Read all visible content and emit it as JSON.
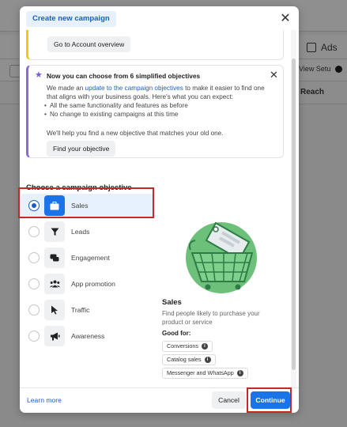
{
  "background": {
    "ads_label": "Ads",
    "view_setup_label": "View Setup",
    "reach_header": "Reach"
  },
  "modal": {
    "title": "Create new campaign",
    "close_icon": "close-icon",
    "top_card": {
      "button_label": "Go to Account overview"
    },
    "info_card": {
      "title": "Now you can choose from 6 simplified objectives",
      "body_prefix": "We made an ",
      "body_link": "update to the campaign objectives",
      "body_suffix": " to make it easier to find one that aligns with your business goals. Here's what you can expect:",
      "bullets": [
        "All the same functionality and features as before",
        "No change to existing campaigns at this time"
      ],
      "footer": "We'll help you find a new objective that matches your old one.",
      "button_label": "Find your objective"
    },
    "objective_section_title": "Choose a campaign objective",
    "objectives": [
      {
        "label": "Sales",
        "icon": "briefcase-icon",
        "selected": true
      },
      {
        "label": "Leads",
        "icon": "funnel-icon",
        "selected": false
      },
      {
        "label": "Engagement",
        "icon": "chat-bubbles-icon",
        "selected": false
      },
      {
        "label": "App promotion",
        "icon": "people-icon",
        "selected": false
      },
      {
        "label": "Traffic",
        "icon": "cursor-icon",
        "selected": false
      },
      {
        "label": "Awareness",
        "icon": "megaphone-icon",
        "selected": false
      }
    ],
    "detail": {
      "title": "Sales",
      "description": "Find people likely to purchase your product or service",
      "good_for_label": "Good for:",
      "chips": [
        "Conversions",
        "Catalog sales",
        "Messenger and WhatsApp"
      ]
    },
    "footer": {
      "learn_more": "Learn more",
      "cancel": "Cancel",
      "continue": "Continue"
    }
  },
  "colors": {
    "accent_blue": "#1a73e8",
    "highlight_red": "#c62828",
    "illustration_green": "#6cc07a"
  }
}
